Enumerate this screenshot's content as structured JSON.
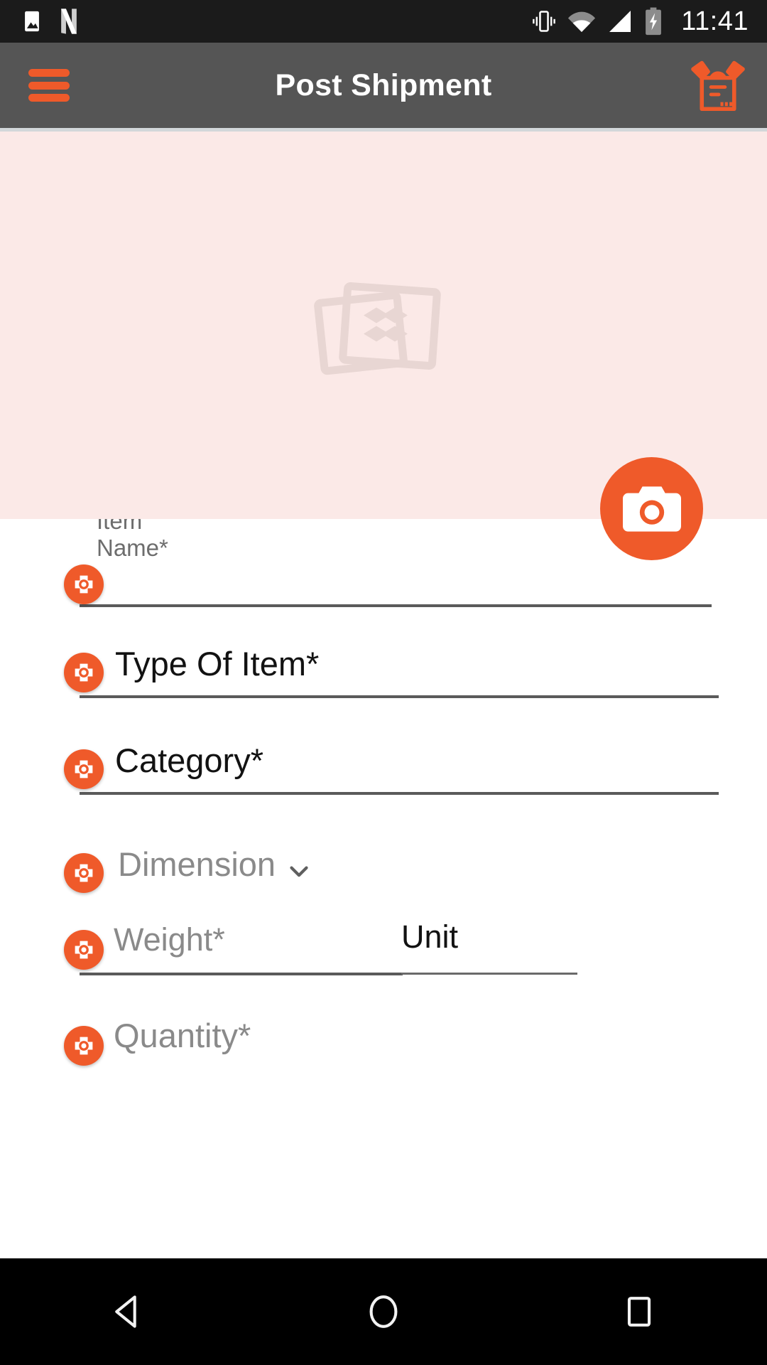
{
  "status_bar": {
    "time": "11:41",
    "left_icons": [
      "photo-icon",
      "netflix-n-icon"
    ],
    "right_icons": [
      "vibrate-icon",
      "wifi-icon",
      "signal-icon",
      "battery-charging-icon"
    ],
    "background_color": "#1b1b1b"
  },
  "app_bar": {
    "title": "Post Shipment",
    "menu_icon": "hamburger-menu-icon",
    "action_icon": "open-box-package-icon",
    "background_color": "#555555",
    "accent_color": "#ef5a2a"
  },
  "photo_panel": {
    "placeholder_icon": "photo-stack-placeholder-icon",
    "background_color": "#fbe9e7",
    "camera_button": {
      "icon": "camera-icon",
      "color": "#ef5a2a"
    }
  },
  "form": {
    "field_badge_icon": "shutter-target-icon",
    "fields": [
      {
        "name": "item-name",
        "floating_label": "Item Name*",
        "value": "",
        "placeholder": "",
        "state": "focused",
        "has_underline": true
      },
      {
        "name": "type-of-item",
        "floating_label": "",
        "value": "Type Of Item*",
        "placeholder": "Type Of Item*",
        "state": "filled",
        "has_underline": true
      },
      {
        "name": "category",
        "floating_label": "",
        "value": "Category*",
        "placeholder": "Category*",
        "state": "filled",
        "has_underline": true
      },
      {
        "name": "dimension",
        "floating_label": "",
        "value": "",
        "placeholder": "Dimension",
        "state": "collapsed-section",
        "has_underline": false,
        "chevron_icon": "chevron-down-icon"
      },
      {
        "name": "weight",
        "floating_label": "",
        "value": "",
        "placeholder": "Weight*",
        "state": "empty",
        "has_underline": true
      },
      {
        "name": "unit",
        "floating_label": "",
        "value": "Unit",
        "placeholder": "Unit",
        "state": "filled",
        "has_underline": true
      },
      {
        "name": "quantity",
        "floating_label": "",
        "value": "",
        "placeholder": "Quantity*",
        "state": "empty",
        "has_underline": false
      }
    ]
  },
  "nav_bar": {
    "back_icon": "back-triangle-icon",
    "home_icon": "home-circle-icon",
    "recents_icon": "recents-square-icon",
    "background_color": "#000000"
  }
}
